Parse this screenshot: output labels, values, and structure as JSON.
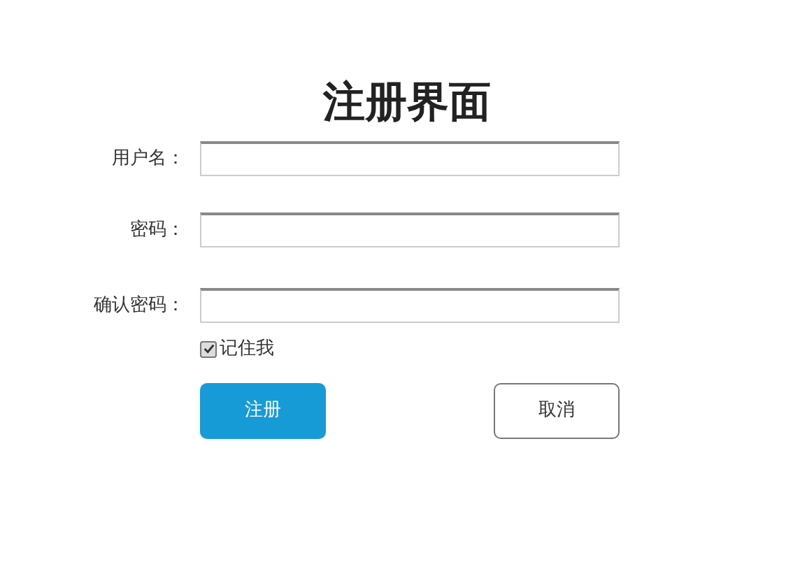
{
  "title": "注册界面",
  "fields": [
    {
      "label": "用户名："
    },
    {
      "label": "密码："
    },
    {
      "label": "确认密码："
    }
  ],
  "remember": {
    "label": "记住我",
    "checked": true
  },
  "buttons": [
    {
      "label": "注册",
      "kind": "primary"
    },
    {
      "label": "取消",
      "kind": "secondary"
    }
  ]
}
